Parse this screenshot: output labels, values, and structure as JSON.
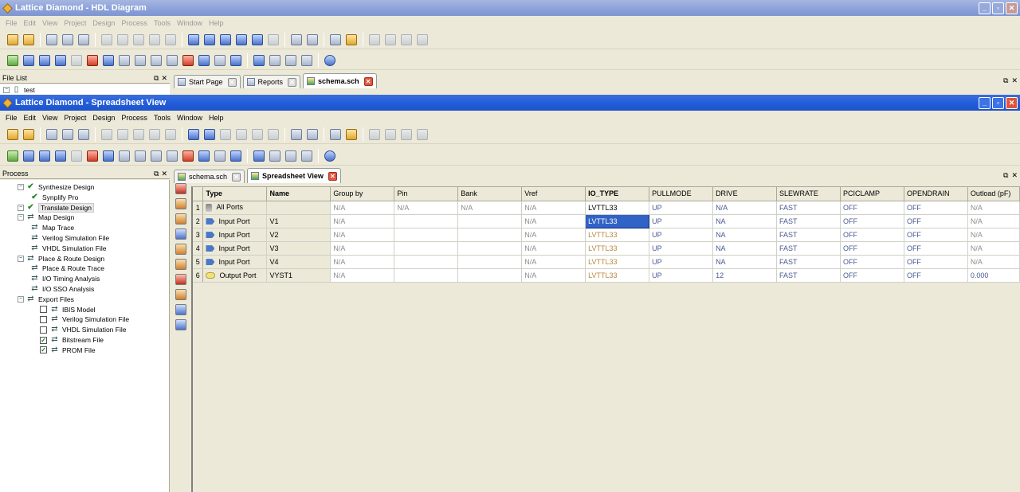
{
  "back_window": {
    "title": "Lattice Diamond - HDL Diagram",
    "menu": [
      "File",
      "Edit",
      "View",
      "Project",
      "Design",
      "Process",
      "Tools",
      "Window",
      "Help"
    ],
    "file_list": {
      "label": "File List",
      "item": "test"
    },
    "tabs": [
      {
        "label": "Start Page"
      },
      {
        "label": "Reports"
      },
      {
        "label": "schema.sch"
      }
    ]
  },
  "front_window": {
    "title": "Lattice Diamond - Spreadsheet View",
    "menu": [
      "File",
      "Edit",
      "View",
      "Project",
      "Design",
      "Process",
      "Tools",
      "Window",
      "Help"
    ],
    "process_panel_label": "Process",
    "tabs": [
      {
        "label": "schema.sch"
      },
      {
        "label": "Spreadsheet View"
      }
    ]
  },
  "process_tree": [
    {
      "label": "Synthesize Design",
      "kind": "group",
      "icon": "check-icon"
    },
    {
      "label": "Synplify Pro",
      "kind": "step",
      "icon": "check-icon"
    },
    {
      "label": "Translate Design",
      "kind": "group",
      "icon": "check-icon",
      "highlight": true
    },
    {
      "label": "Map Design",
      "kind": "group",
      "icon": "run-icon"
    },
    {
      "label": "Map Trace",
      "kind": "step",
      "icon": "run-icon"
    },
    {
      "label": "Verilog Simulation File",
      "kind": "step",
      "icon": "run-icon"
    },
    {
      "label": "VHDL Simulation File",
      "kind": "step",
      "icon": "run-icon"
    },
    {
      "label": "Place & Route Design",
      "kind": "group",
      "icon": "run-icon"
    },
    {
      "label": "Place & Route Trace",
      "kind": "step",
      "icon": "run-icon"
    },
    {
      "label": "I/O Timing Analysis",
      "kind": "step",
      "icon": "run-icon"
    },
    {
      "label": "I/O SSO Analysis",
      "kind": "step",
      "icon": "run-icon"
    },
    {
      "label": "Export Files",
      "kind": "group",
      "icon": "run-icon"
    },
    {
      "label": "IBIS Model",
      "kind": "export",
      "checked": false
    },
    {
      "label": "Verilog Simulation File",
      "kind": "export",
      "checked": false
    },
    {
      "label": "VHDL Simulation File",
      "kind": "export",
      "checked": false
    },
    {
      "label": "Bitstream File",
      "kind": "export",
      "checked": true
    },
    {
      "label": "PROM File",
      "kind": "export",
      "checked": true
    }
  ],
  "spreadsheet": {
    "columns": [
      "Type",
      "Name",
      "Group by",
      "Pin",
      "Bank",
      "Vref",
      "IO_TYPE",
      "PULLMODE",
      "DRIVE",
      "SLEWRATE",
      "PCICLAMP",
      "OPENDRAIN",
      "Outload (pF)"
    ],
    "rows": [
      {
        "num": "1",
        "type": "All Ports",
        "name": "",
        "group": "N/A",
        "pin": "N/A",
        "bank": "N/A",
        "vref": "N/A",
        "io_type": "LVTTL33",
        "pullmode": "UP",
        "drive": "N/A",
        "slewrate": "FAST",
        "pciclamp": "OFF",
        "opendrain": "OFF",
        "outload": "N/A"
      },
      {
        "num": "2",
        "type": "Input Port",
        "name": "V1",
        "group": "N/A",
        "pin": "",
        "bank": "",
        "vref": "N/A",
        "io_type": "LVTTL33",
        "pullmode": "UP",
        "drive": "NA",
        "slewrate": "FAST",
        "pciclamp": "OFF",
        "opendrain": "OFF",
        "outload": "N/A"
      },
      {
        "num": "3",
        "type": "Input Port",
        "name": "V2",
        "group": "N/A",
        "pin": "",
        "bank": "",
        "vref": "N/A",
        "io_type": "LVTTL33",
        "pullmode": "UP",
        "drive": "NA",
        "slewrate": "FAST",
        "pciclamp": "OFF",
        "opendrain": "OFF",
        "outload": "N/A"
      },
      {
        "num": "4",
        "type": "Input Port",
        "name": "V3",
        "group": "N/A",
        "pin": "",
        "bank": "",
        "vref": "N/A",
        "io_type": "LVTTL33",
        "pullmode": "UP",
        "drive": "NA",
        "slewrate": "FAST",
        "pciclamp": "OFF",
        "opendrain": "OFF",
        "outload": "N/A"
      },
      {
        "num": "5",
        "type": "Input Port",
        "name": "V4",
        "group": "N/A",
        "pin": "",
        "bank": "",
        "vref": "N/A",
        "io_type": "LVTTL33",
        "pullmode": "UP",
        "drive": "NA",
        "slewrate": "FAST",
        "pciclamp": "OFF",
        "opendrain": "OFF",
        "outload": "N/A"
      },
      {
        "num": "6",
        "type": "Output Port",
        "name": "VYST1",
        "group": "N/A",
        "pin": "",
        "bank": "",
        "vref": "N/A",
        "io_type": "LVTTL33",
        "pullmode": "UP",
        "drive": "12",
        "slewrate": "FAST",
        "pciclamp": "OFF",
        "opendrain": "OFF",
        "outload": "0.000"
      }
    ]
  },
  "colors": {
    "title_active": "#245edb",
    "title_inactive": "#8aa0d8",
    "selection": "#3162c6",
    "io_type_text": "#b8883a"
  }
}
